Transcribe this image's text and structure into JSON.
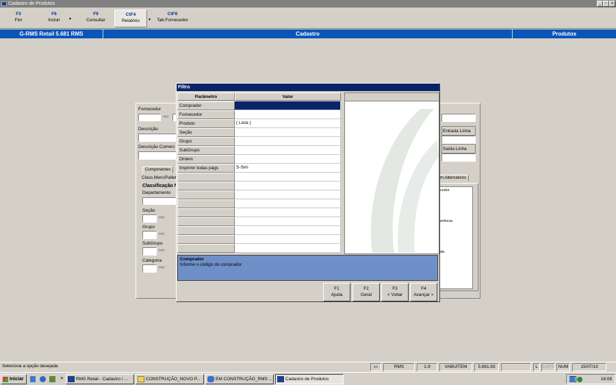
{
  "window": {
    "title": "Cadastro de Produtos",
    "controls": [
      "_",
      "▫",
      "x"
    ]
  },
  "toolbar": [
    {
      "key": "F3",
      "label": "Fim"
    },
    {
      "key": "F6",
      "label": "Incluir"
    },
    {
      "key": "F9",
      "label": "Consultar"
    },
    {
      "key": "CtF4",
      "label": "Relatório"
    },
    {
      "key": "CtF8",
      "label": "Tab.Fornecedor"
    }
  ],
  "header": {
    "app": "G-RMS Retail 5.681 RMS",
    "center": "Cadastro",
    "right": "Produtos"
  },
  "form": {
    "fornecedor": "Fornecedor",
    "descricao": "Descrição",
    "descricao_comercial": "Descrição Comerc",
    "tab_componentes": "Componentes",
    "class_merc": "Class.Merc/Pallet",
    "classificacao": "Classificação N",
    "departamento": "Departamento",
    "secao": "Seção",
    "grupo": "Grupo",
    "subgrupo": "SubGrupo",
    "categoria": "Categoria",
    "entrada_linha": "Entrada Linha",
    "saida_linha": "Saída Linha",
    "alternativos": "m.Alternativos",
    "cedor": "cedor",
    "erencia": "erência",
    "da": "da"
  },
  "dialog": {
    "title": "Filtro",
    "col_param": "Parâmetro",
    "col_valor": "Valor",
    "rows": [
      {
        "param": "Comprador",
        "valor": ""
      },
      {
        "param": "Fornecedor",
        "valor": ""
      },
      {
        "param": "Produto",
        "valor": "( Lista )"
      },
      {
        "param": "Seção",
        "valor": ""
      },
      {
        "param": "Grupo",
        "valor": ""
      },
      {
        "param": "SubGrupo",
        "valor": ""
      },
      {
        "param": "Ordem",
        "valor": ""
      },
      {
        "param": "Imprimir todas págs",
        "valor": "S-Sim"
      }
    ],
    "info_title": "Comprador",
    "info_text": "Informe o código do comprador",
    "buttons": [
      {
        "key": "F1",
        "label": "Ajuda"
      },
      {
        "key": "F2",
        "label": "Geral"
      },
      {
        "key": "F3",
        "label": "< Voltar"
      },
      {
        "key": "F4",
        "label": "Avançar >"
      }
    ]
  },
  "status": {
    "message": "Seleciona a opção desejada",
    "rms": "RMS",
    "range": "1-9",
    "user": "VABUITEM",
    "version": "5.681.63",
    "l": "L",
    "caps": "CAPS",
    "num": "NUM",
    "date": "15/07/13"
  },
  "taskbar": {
    "start": "Iniciar",
    "chevron": "»",
    "tasks": [
      "RMS Retail - Cadastro / ...",
      "CONSTRUÇÃO_NOVO P...",
      "EM CONSTRUÇÃO_RMS ...",
      "Cadastro de Produtos"
    ],
    "time": "16:08"
  }
}
